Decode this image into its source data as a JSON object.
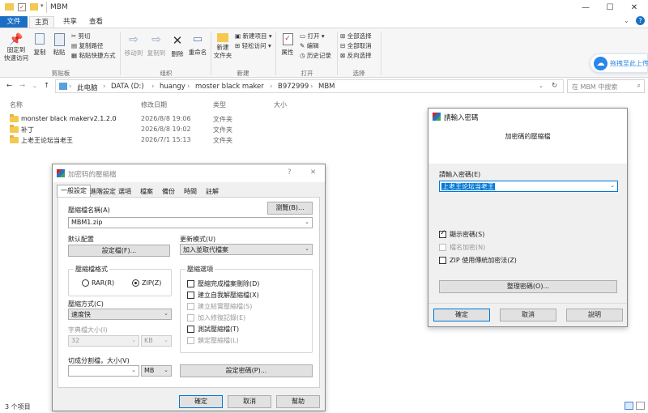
{
  "window": {
    "title": "MBM",
    "minimize_glyph": "—",
    "maximize_glyph": "☐",
    "close_glyph": "✕"
  },
  "ribbon_tabs": [
    "文件",
    "主页",
    "共享",
    "查看"
  ],
  "ribbon": {
    "clipboard": {
      "pin": "固定到\n快速访问",
      "copy": "复制",
      "paste": "粘贴",
      "cut": "剪切",
      "copy_path": "复制路径",
      "paste_shortcut": "粘贴快捷方式",
      "group": "剪贴板"
    },
    "organize": {
      "move_to": "移动到",
      "copy_to": "复制到",
      "delete": "删除",
      "rename": "重命名",
      "group": "组织"
    },
    "new": {
      "new_folder": "新建\n文件夹",
      "new_item": "新建项目 ▾",
      "easy_access": "轻松访问 ▾",
      "group": "新建"
    },
    "open": {
      "properties": "属性",
      "open": "打开 ▾",
      "edit": "编辑",
      "history": "历史记录",
      "group": "打开"
    },
    "select": {
      "select_all": "全部选择",
      "select_none": "全部取消",
      "invert": "反向选择",
      "group": "选择"
    }
  },
  "cloud_widget": {
    "text": "拖拽至此上传"
  },
  "address": {
    "crumbs": [
      "此电脑",
      "DATA (D:)",
      "huangy",
      "moster black maker",
      "B972999",
      "MBM"
    ],
    "separator": "›",
    "search_placeholder": "在 MBM 中搜索"
  },
  "columns": {
    "name": "名称",
    "modified": "修改日期",
    "type": "类型",
    "size": "大小"
  },
  "files": [
    {
      "name": "monster black makerv2.1.2.0",
      "modified": "2026/8/8 19:06",
      "type": "文件夹"
    },
    {
      "name": "补丁",
      "modified": "2026/8/8 19:02",
      "type": "文件夹"
    },
    {
      "name": "上老王论坛当老王",
      "modified": "2026/7/1 15:13",
      "type": "文件夹"
    }
  ],
  "status_bar": {
    "count": "3 个项目"
  },
  "archive_dialog": {
    "title": "加密码的壓縮檔",
    "help_glyph": "?",
    "close_glyph": "✕",
    "tabs": [
      "一般設定",
      "進階設定",
      "選項",
      "檔案",
      "備份",
      "時間",
      "註解"
    ],
    "archive_name_label": "壓縮檔名稱(A)",
    "browse_button": "瀏覽(B)...",
    "archive_name_value": "MBM1.zip",
    "default_profile_label": "默认配置",
    "profile_button": "設定檔(F)...",
    "update_mode_label": "更新模式(U)",
    "update_mode_value": "加入並取代檔案",
    "format_group": "壓縮檔格式",
    "format_rar": "RAR(R)",
    "format_zip": "ZIP(Z)",
    "options_group": "壓縮選項",
    "options": [
      {
        "label": "壓縮完成檔案刪除(D)",
        "checked": false,
        "enabled": true
      },
      {
        "label": "建立自我解壓縮檔(X)",
        "checked": false,
        "enabled": true
      },
      {
        "label": "建立結實壓縮檔(S)",
        "checked": false,
        "enabled": false
      },
      {
        "label": "加入修復記錄(E)",
        "checked": false,
        "enabled": false
      },
      {
        "label": "測試壓縮檔(T)",
        "checked": false,
        "enabled": true
      },
      {
        "label": "鎖定壓縮檔(L)",
        "checked": false,
        "enabled": false
      }
    ],
    "method_label": "壓縮方式(C)",
    "method_value": "速度快",
    "dict_label": "字典檔大小(I)",
    "dict_value": "32",
    "dict_unit": "KB",
    "split_label": "切成分割檔，大小(V)",
    "split_value": "",
    "split_unit": "MB",
    "set_password_button": "設定密碼(P)...",
    "ok": "確定",
    "cancel": "取消",
    "help": "幫助"
  },
  "password_dialog": {
    "title": "請輸入密碼",
    "subtitle": "加密碼的壓縮檔",
    "enter_label": "請輸入密碼(E)",
    "password_value": "上老王论坛当老王",
    "show_password": "顯示密碼(S)",
    "encrypt_names": "檔名加密(N)",
    "zip_legacy": "ZIP 使用傳統加密法(Z)",
    "organize_button": "整理密碼(O)...",
    "ok": "確定",
    "cancel": "取消",
    "help": "說明"
  },
  "colors": {
    "accent": "#1a6fc4",
    "folder": "#f3c94f",
    "selection": "#0078d7"
  }
}
